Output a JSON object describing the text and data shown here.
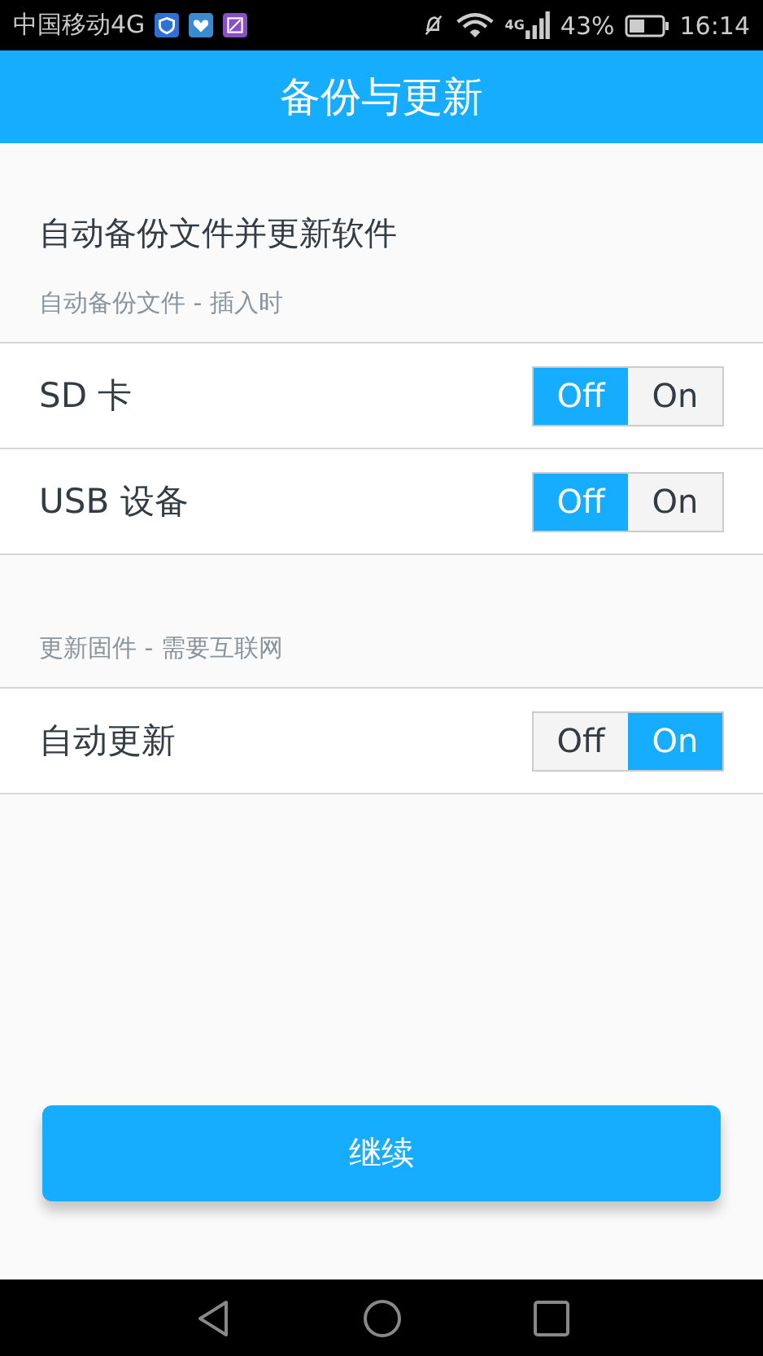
{
  "status_bar": {
    "carrier": "中国移动4G",
    "network": "4G",
    "battery": "43%",
    "time": "16:14"
  },
  "header": {
    "title": "备份与更新"
  },
  "heading": "自动备份文件并更新软件",
  "sections": [
    {
      "subtitle": "自动备份文件 - 插入时",
      "rows": [
        {
          "label": "SD 卡",
          "off_label": "Off",
          "on_label": "On",
          "on": false
        },
        {
          "label": "USB 设备",
          "off_label": "Off",
          "on_label": "On",
          "on": false
        }
      ]
    },
    {
      "subtitle": "更新固件 - 需要互联网",
      "rows": [
        {
          "label": "自动更新",
          "off_label": "Off",
          "on_label": "On",
          "on": true
        }
      ]
    }
  ],
  "continue_button": "继续"
}
